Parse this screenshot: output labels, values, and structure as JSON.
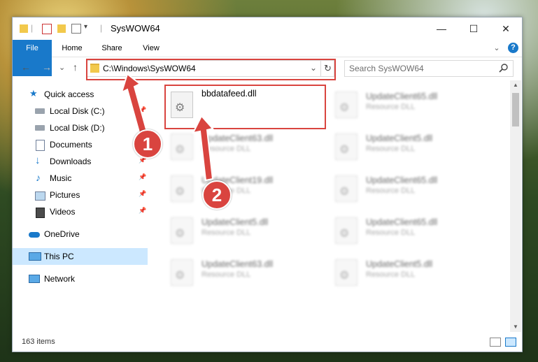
{
  "window": {
    "title": "SysWOW64"
  },
  "controls": {
    "minimize": "—",
    "maximize": "☐",
    "close": "✕"
  },
  "ribbon": {
    "tabs": [
      "File",
      "Home",
      "Share",
      "View"
    ],
    "expand": "⌄",
    "help": "?"
  },
  "nav": {
    "back": "←",
    "forward": "→",
    "recent": "⌄",
    "up": "↑",
    "refresh": "↻",
    "dropdown": "⌄"
  },
  "address": {
    "path": "C:\\Windows\\SysWOW64"
  },
  "search": {
    "placeholder": "Search SysWOW64",
    "icon": "magnifier-icon"
  },
  "sidebar": {
    "items": [
      {
        "label": "Quick access",
        "icon": "star-icon"
      },
      {
        "label": "Local Disk (C:)",
        "icon": "drive-icon"
      },
      {
        "label": "Local Disk (D:)",
        "icon": "drive-icon"
      },
      {
        "label": "Documents",
        "icon": "documents-icon"
      },
      {
        "label": "Downloads",
        "icon": "download-icon"
      },
      {
        "label": "Music",
        "icon": "music-icon"
      },
      {
        "label": "Pictures",
        "icon": "pictures-icon"
      },
      {
        "label": "Videos",
        "icon": "videos-icon"
      },
      {
        "label": "OneDrive",
        "icon": "cloud-icon"
      },
      {
        "label": "This PC",
        "icon": "computer-icon"
      },
      {
        "label": "Network",
        "icon": "network-icon"
      }
    ]
  },
  "files": [
    {
      "name": "bbdatafeed.dll",
      "type": ""
    },
    {
      "name": "UpdateClient65.dll",
      "type": "Resource DLL"
    },
    {
      "name": "UpdateClient63.dll",
      "type": "Resource DLL"
    },
    {
      "name": "UpdateClient5.dll",
      "type": "Resource DLL"
    },
    {
      "name": "UpdateClient19.dll",
      "type": "Resource DLL"
    },
    {
      "name": "UpdateClient65.dll",
      "type": "Resource DLL"
    },
    {
      "name": "UpdateClient5.dll",
      "type": "Resource DLL"
    },
    {
      "name": "UpdateClient65.dll",
      "type": "Resource DLL"
    },
    {
      "name": "UpdateClient63.dll",
      "type": "Resource DLL"
    },
    {
      "name": "UpdateClient5.dll",
      "type": "Resource DLL"
    }
  ],
  "status": {
    "count": "163 items"
  },
  "annotations": {
    "step1": "1",
    "step2": "2",
    "color": "#d9443f"
  }
}
